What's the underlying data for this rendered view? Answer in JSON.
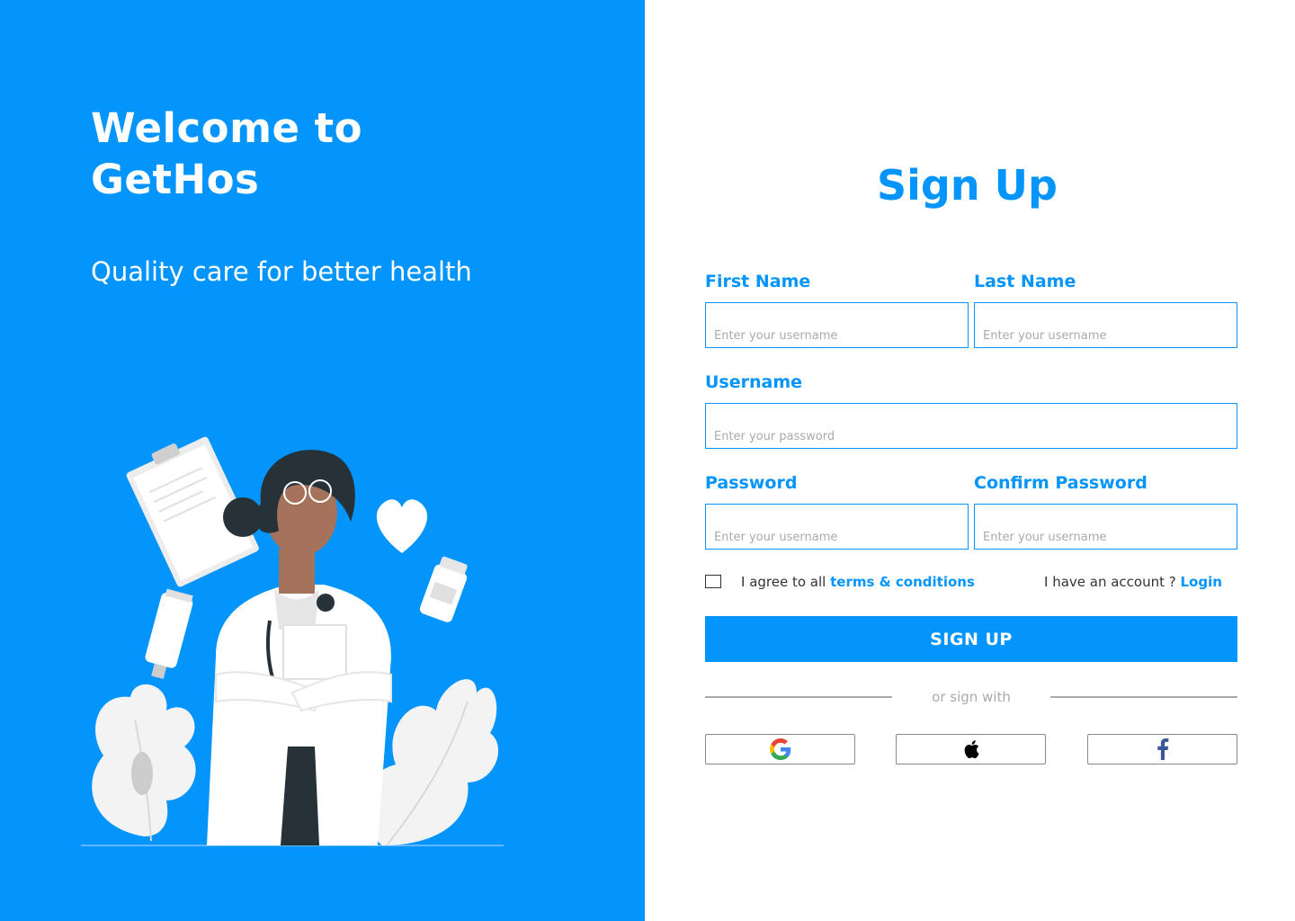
{
  "hero": {
    "welcome_line1": "Welcome to",
    "welcome_line2": "GetHos",
    "tagline": "Quality care for better health",
    "background_color": "#0394fc"
  },
  "form": {
    "title": "Sign Up",
    "first_name": {
      "label": "First Name",
      "placeholder": "Enter your username"
    },
    "last_name": {
      "label": "Last Name",
      "placeholder": "Enter your username"
    },
    "username": {
      "label": "Username",
      "placeholder": "Enter your password"
    },
    "password": {
      "label": "Password",
      "placeholder": "Enter your username"
    },
    "confirm_password": {
      "label": "Confirm Password",
      "placeholder": "Enter your username"
    },
    "agree_prefix": "I agree to all ",
    "terms_link": "terms & conditions",
    "account_prefix": "I have an account ? ",
    "login_link": "Login",
    "submit_label": "SIGN UP",
    "divider_text": "or sign  with",
    "accent_color": "#0394fc"
  },
  "social": [
    {
      "icon": "google-icon"
    },
    {
      "icon": "apple-icon"
    },
    {
      "icon": "facebook-icon"
    }
  ]
}
